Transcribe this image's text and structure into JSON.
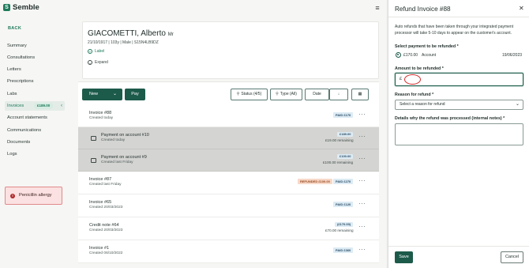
{
  "app": {
    "logo_text": "Semble",
    "logo_letter": "S",
    "menu_icon": "hamburger-icon"
  },
  "sidebar": {
    "back_label": "BACK",
    "items": [
      {
        "label": "Summary"
      },
      {
        "label": "Consultations"
      },
      {
        "label": "Letters"
      },
      {
        "label": "Prescriptions"
      },
      {
        "label": "Labs"
      },
      {
        "label": "Invoices",
        "badge": "£189.00",
        "active": true
      },
      {
        "label": "Account statements"
      },
      {
        "label": "Communications"
      },
      {
        "label": "Documents"
      },
      {
        "label": "Logs"
      }
    ],
    "allergy": {
      "icon": "!",
      "text": "Penicillin allergy"
    }
  },
  "patient": {
    "name": "GIACOMETTI, Alberto",
    "title": "Mr",
    "meta": "21/10/1917  |  103y  |  Male  |  S15N4LB9DZ",
    "label_link": "Label",
    "expand_link": "Expand"
  },
  "toolbar": {
    "new_label": "New",
    "pay_label": "Pay",
    "status_filter": "Status (4/5)",
    "type_filter": "Type (All)",
    "date_label": "Date"
  },
  "rows": [
    {
      "title": "Invoice #88",
      "sub": "Created today",
      "status": "PAID £170"
    },
    {
      "title": "Payment on account #10",
      "sub": "Created today",
      "amount": "£189.00",
      "remaining": "£19.00 remaining",
      "grey": true
    },
    {
      "title": "Payment on account #9",
      "sub": "Created last Friday",
      "amount": "£100.00",
      "remaining": "£100.00 remaining",
      "grey": true
    },
    {
      "title": "Invoice #87",
      "sub": "Created last Friday",
      "refund": "REFUNDED £100.00",
      "status": "PAID £270"
    },
    {
      "title": "Invoice #65",
      "sub": "Created 20/03/2023",
      "status": "PAID £120"
    },
    {
      "title": "Credit note #64",
      "sub": "Created 20/03/2023",
      "amount": "(£170.00)",
      "remaining": "£70.00 remaining"
    },
    {
      "title": "Invoice #1",
      "sub": "Created 06/10/2022",
      "status": "PAID £360"
    }
  ],
  "drawer": {
    "title": "Refund Invoice #88",
    "close_icon": "close-icon",
    "note": "Auto refunds that have been taken through your integrated payment processor will take 5-10 days to appear on the customer's account.",
    "payment_label": "Select payment to be refunded *",
    "payment": {
      "amount": "£170.00",
      "method": "Account",
      "date": "19/06/2023"
    },
    "amount_label": "Amount to be refunded *",
    "amount_prefix": "£",
    "amount_value": "",
    "reason_label": "Reason for refund *",
    "reason_placeholder": "Select a reason for refund",
    "details_label": "Details why the refund was processed (internal notes) *",
    "details_value": "",
    "save_label": "Save",
    "cancel_label": "Cancel"
  },
  "colors": {
    "brand": "#1c5a4a",
    "accent": "#1c7a5a",
    "allergy_bg": "#fbe1e1",
    "focus": "#d22c2c"
  }
}
